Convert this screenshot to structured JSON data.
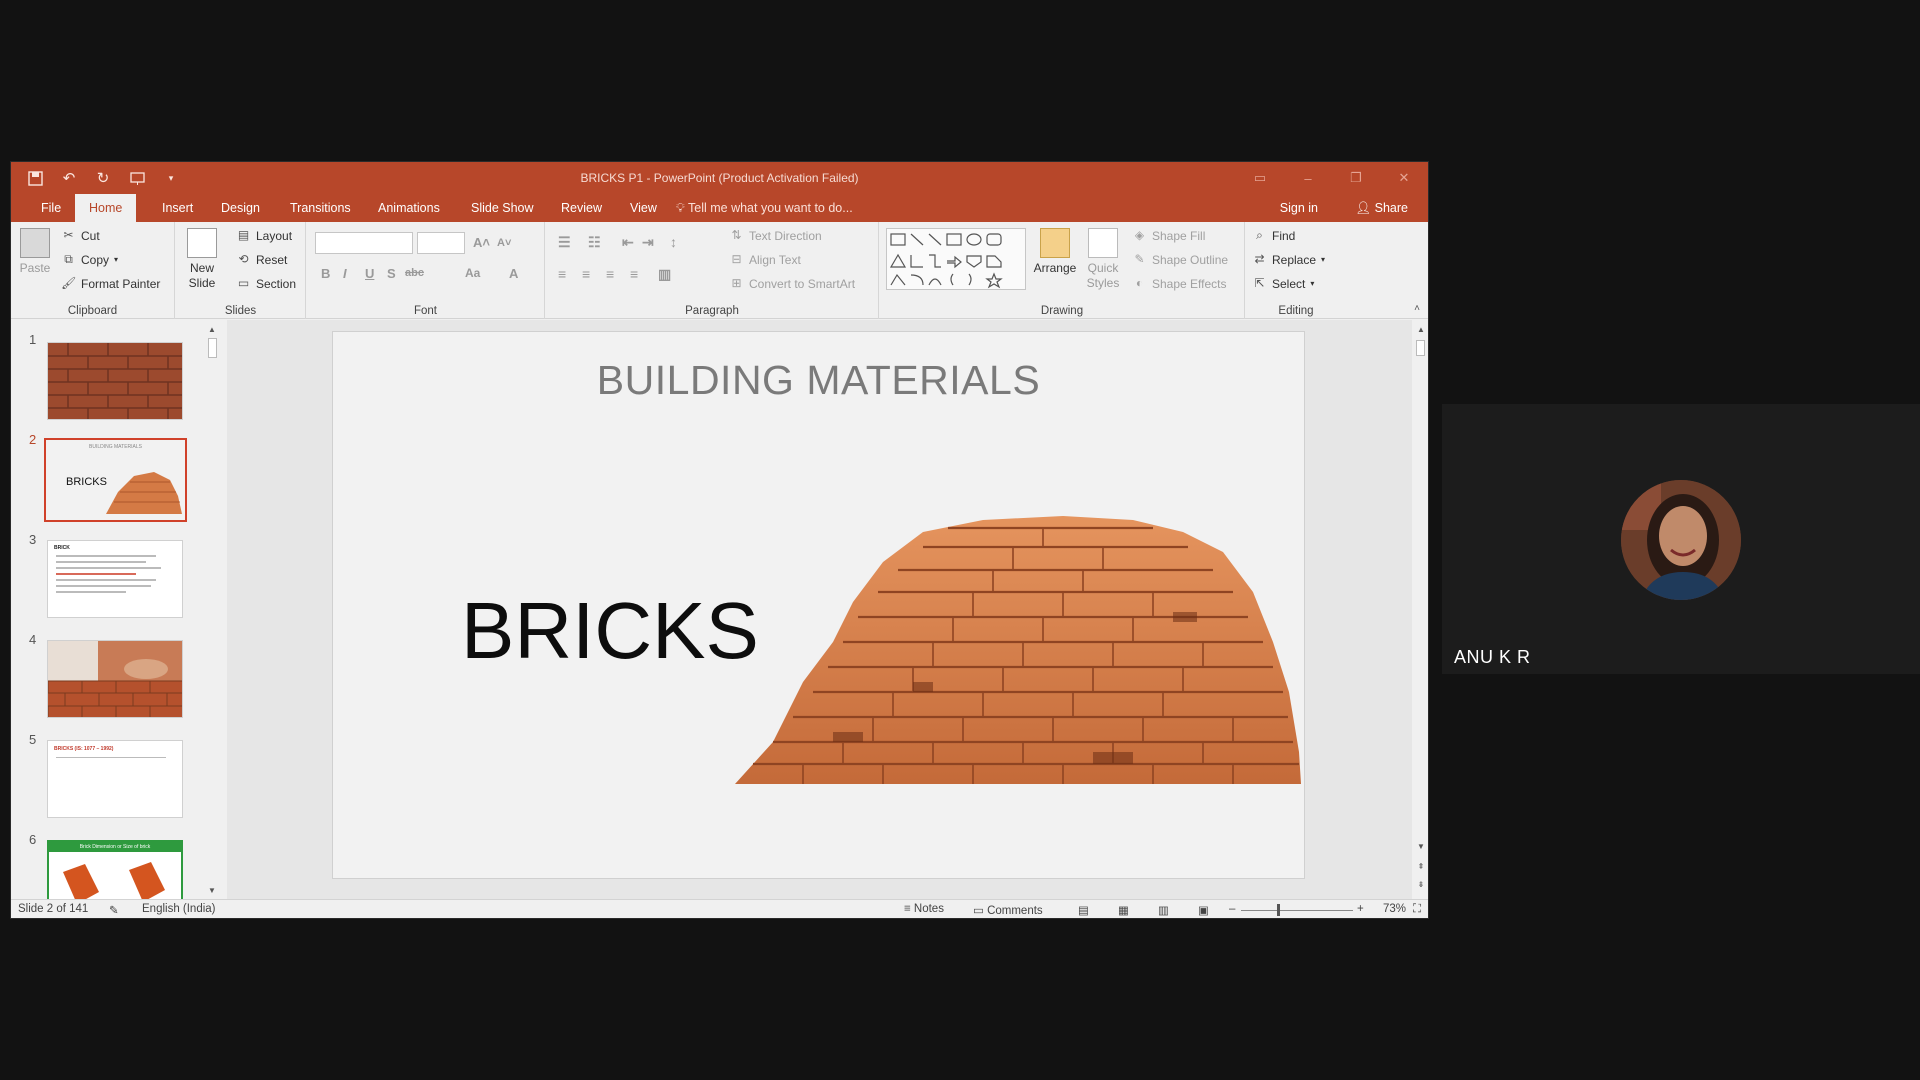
{
  "window": {
    "title": "BRICKS P1 - PowerPoint (Product Activation Failed)"
  },
  "tabs": [
    "File",
    "Home",
    "Insert",
    "Design",
    "Transitions",
    "Animations",
    "Slide Show",
    "Review",
    "View"
  ],
  "tell_me": "Tell me what you want to do...",
  "sign_in": "Sign in",
  "share": "Share",
  "ribbon": {
    "clipboard": {
      "label": "Clipboard",
      "paste": "Paste",
      "cut": "Cut",
      "copy": "Copy",
      "format_painter": "Format Painter"
    },
    "slides": {
      "label": "Slides",
      "new_slide": "New Slide",
      "layout": "Layout",
      "reset": "Reset",
      "section": "Section"
    },
    "font": {
      "label": "Font",
      "bold": "B",
      "italic": "I",
      "underline": "U",
      "shadow": "S",
      "strike": "abc",
      "aa": "Aa"
    },
    "paragraph": {
      "label": "Paragraph",
      "text_direction": "Text Direction",
      "align_text": "Align Text",
      "convert_smartart": "Convert to SmartArt"
    },
    "drawing": {
      "label": "Drawing",
      "arrange": "Arrange",
      "quick_styles": "Quick Styles",
      "shape_fill": "Shape Fill",
      "shape_outline": "Shape Outline",
      "shape_effects": "Shape Effects"
    },
    "editing": {
      "label": "Editing",
      "find": "Find",
      "replace": "Replace",
      "select": "Select"
    }
  },
  "thumbnails": [
    {
      "num": "1",
      "kind": "brick-wall"
    },
    {
      "num": "2",
      "kind": "title-bricks",
      "title": "BUILDING MATERIALS",
      "text": "BRICKS"
    },
    {
      "num": "3",
      "kind": "text-bullets",
      "heading": "BRICK"
    },
    {
      "num": "4",
      "kind": "bricklaying"
    },
    {
      "num": "5",
      "kind": "text-heading",
      "heading": "BRICKS (IS: 1077 – 1992)"
    },
    {
      "num": "6",
      "kind": "brick-dimension",
      "heading": "Brick Dimension or Size of brick"
    }
  ],
  "slide": {
    "title": "BUILDING MATERIALS",
    "main_text": "BRICKS"
  },
  "status": {
    "slide_info": "Slide 2 of 141",
    "language": "English (India)",
    "notes": "Notes",
    "comments": "Comments",
    "zoom": "73%"
  },
  "participant": {
    "name": "ANU K R"
  },
  "colors": {
    "accent": "#b7472a",
    "selected_thumb_border": "#d0412a"
  }
}
